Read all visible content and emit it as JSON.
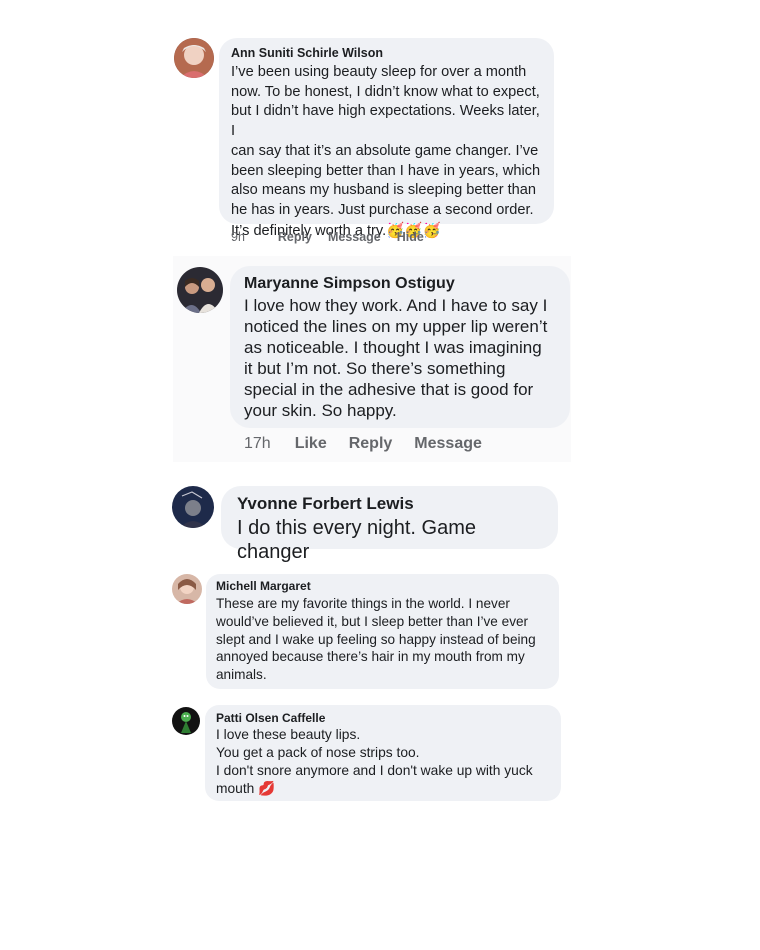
{
  "comments": [
    {
      "author": "Ann Suniti Schirle Wilson",
      "text": "I’ve been using beauty sleep for over a month\nnow. To be honest, I didn’t know what to expect,\nbut I didn’t have high expectations. Weeks later, I\ncan say that it’s an absolute game changer. I’ve\nbeen sleeping better than I have in years, which\nalso means my husband is sleeping better than\nhe has in years. Just purchase a second order.\nIt’s definitely worth a try.",
      "emoji": "🥳🥳🥳",
      "time": "9h",
      "actions": [
        "Reply",
        "Message",
        "Hide"
      ]
    },
    {
      "author": "Maryanne Simpson Ostiguy",
      "text": "I love how they work.  And I have to say I\nnoticed the lines on my upper lip weren’t\nas noticeable.  I thought I was imagining\nit but I’m not.  So there’s something\nspecial in the adhesive that is good for\nyour skin.  So happy.",
      "time": "17h",
      "actions": [
        "Like",
        "Reply",
        "Message"
      ]
    },
    {
      "author": "Yvonne Forbert Lewis",
      "text": "I do this every night. Game changer"
    },
    {
      "author": "Michell Margaret",
      "text": "These are my favorite things in the world. I never\nwould’ve believed it, but I sleep better than I’ve ever\nslept and I wake up feeling so happy instead of being\nannoyed because there’s hair in my mouth from my\nanimals."
    },
    {
      "author": "Patti Olsen Caffelle",
      "text": "I love these beauty lips.\nYou get a pack of nose strips too.\nI don't snore anymore and I don't wake up with yuck\nmouth",
      "emoji": "💋"
    }
  ],
  "icons": {
    "avatar_style": "profile-photo"
  },
  "colors": {
    "bubble": "#eff1f5",
    "meta_text": "#65676b",
    "name_text": "#1c1e21"
  }
}
